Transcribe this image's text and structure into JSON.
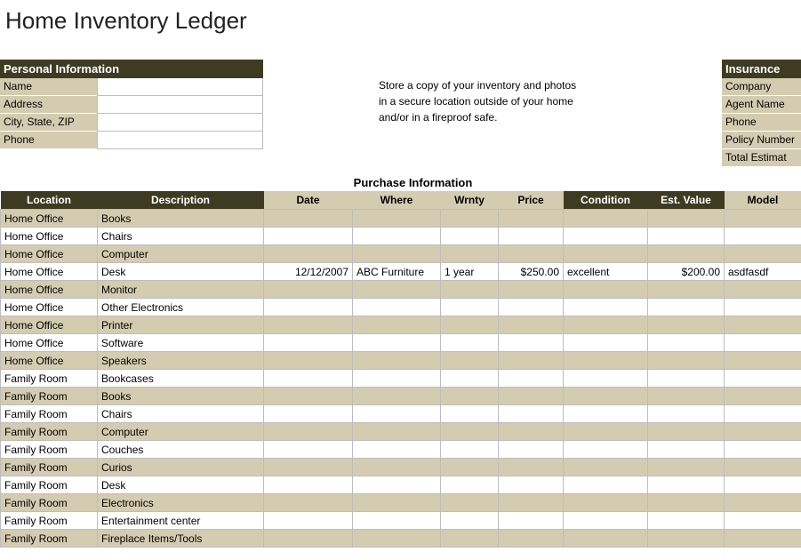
{
  "title": "Home Inventory Ledger",
  "personal": {
    "header": "Personal Information",
    "labels": {
      "name": "Name",
      "address": "Address",
      "csz": "City, State, ZIP",
      "phone": "Phone"
    }
  },
  "note": {
    "line1": "Store a copy of your inventory and photos",
    "line2": "in a secure location outside of your home",
    "line3": "and/or in a fireproof safe."
  },
  "insurance": {
    "header": "Insurance",
    "labels": {
      "company": "Company",
      "agent": "Agent Name",
      "phone": "Phone",
      "policy": "Policy Number",
      "total": "Total Estimat"
    }
  },
  "purchase_title": "Purchase Information",
  "columns": {
    "location": "Location",
    "description": "Description",
    "date": "Date",
    "where": "Where",
    "wrnty": "Wrnty",
    "price": "Price",
    "condition": "Condition",
    "est": "Est. Value",
    "model": "Model"
  },
  "rows": [
    {
      "location": "Home Office",
      "desc": "Books",
      "date": "",
      "where": "",
      "wrnty": "",
      "price": "",
      "cond": "",
      "est": "",
      "model": ""
    },
    {
      "location": "Home Office",
      "desc": "Chairs",
      "date": "",
      "where": "",
      "wrnty": "",
      "price": "",
      "cond": "",
      "est": "",
      "model": ""
    },
    {
      "location": "Home Office",
      "desc": "Computer",
      "date": "",
      "where": "",
      "wrnty": "",
      "price": "",
      "cond": "",
      "est": "",
      "model": ""
    },
    {
      "location": "Home Office",
      "desc": "Desk",
      "date": "12/12/2007",
      "where": "ABC Furniture",
      "wrnty": "1 year",
      "price": "$250.00",
      "cond": "excellent",
      "est": "$200.00",
      "model": "asdfasdf"
    },
    {
      "location": "Home Office",
      "desc": "Monitor",
      "date": "",
      "where": "",
      "wrnty": "",
      "price": "",
      "cond": "",
      "est": "",
      "model": ""
    },
    {
      "location": "Home Office",
      "desc": "Other Electronics",
      "date": "",
      "where": "",
      "wrnty": "",
      "price": "",
      "cond": "",
      "est": "",
      "model": ""
    },
    {
      "location": "Home Office",
      "desc": "Printer",
      "date": "",
      "where": "",
      "wrnty": "",
      "price": "",
      "cond": "",
      "est": "",
      "model": ""
    },
    {
      "location": "Home Office",
      "desc": "Software",
      "date": "",
      "where": "",
      "wrnty": "",
      "price": "",
      "cond": "",
      "est": "",
      "model": ""
    },
    {
      "location": "Home Office",
      "desc": "Speakers",
      "date": "",
      "where": "",
      "wrnty": "",
      "price": "",
      "cond": "",
      "est": "",
      "model": ""
    },
    {
      "location": "Family Room",
      "desc": "Bookcases",
      "date": "",
      "where": "",
      "wrnty": "",
      "price": "",
      "cond": "",
      "est": "",
      "model": ""
    },
    {
      "location": "Family Room",
      "desc": "Books",
      "date": "",
      "where": "",
      "wrnty": "",
      "price": "",
      "cond": "",
      "est": "",
      "model": ""
    },
    {
      "location": "Family Room",
      "desc": "Chairs",
      "date": "",
      "where": "",
      "wrnty": "",
      "price": "",
      "cond": "",
      "est": "",
      "model": ""
    },
    {
      "location": "Family Room",
      "desc": "Computer",
      "date": "",
      "where": "",
      "wrnty": "",
      "price": "",
      "cond": "",
      "est": "",
      "model": ""
    },
    {
      "location": "Family Room",
      "desc": "Couches",
      "date": "",
      "where": "",
      "wrnty": "",
      "price": "",
      "cond": "",
      "est": "",
      "model": ""
    },
    {
      "location": "Family Room",
      "desc": "Curios",
      "date": "",
      "where": "",
      "wrnty": "",
      "price": "",
      "cond": "",
      "est": "",
      "model": ""
    },
    {
      "location": "Family Room",
      "desc": "Desk",
      "date": "",
      "where": "",
      "wrnty": "",
      "price": "",
      "cond": "",
      "est": "",
      "model": ""
    },
    {
      "location": "Family Room",
      "desc": "Electronics",
      "date": "",
      "where": "",
      "wrnty": "",
      "price": "",
      "cond": "",
      "est": "",
      "model": ""
    },
    {
      "location": "Family Room",
      "desc": "Entertainment center",
      "date": "",
      "where": "",
      "wrnty": "",
      "price": "",
      "cond": "",
      "est": "",
      "model": ""
    },
    {
      "location": "Family Room",
      "desc": "Fireplace Items/Tools",
      "date": "",
      "where": "",
      "wrnty": "",
      "price": "",
      "cond": "",
      "est": "",
      "model": ""
    }
  ]
}
